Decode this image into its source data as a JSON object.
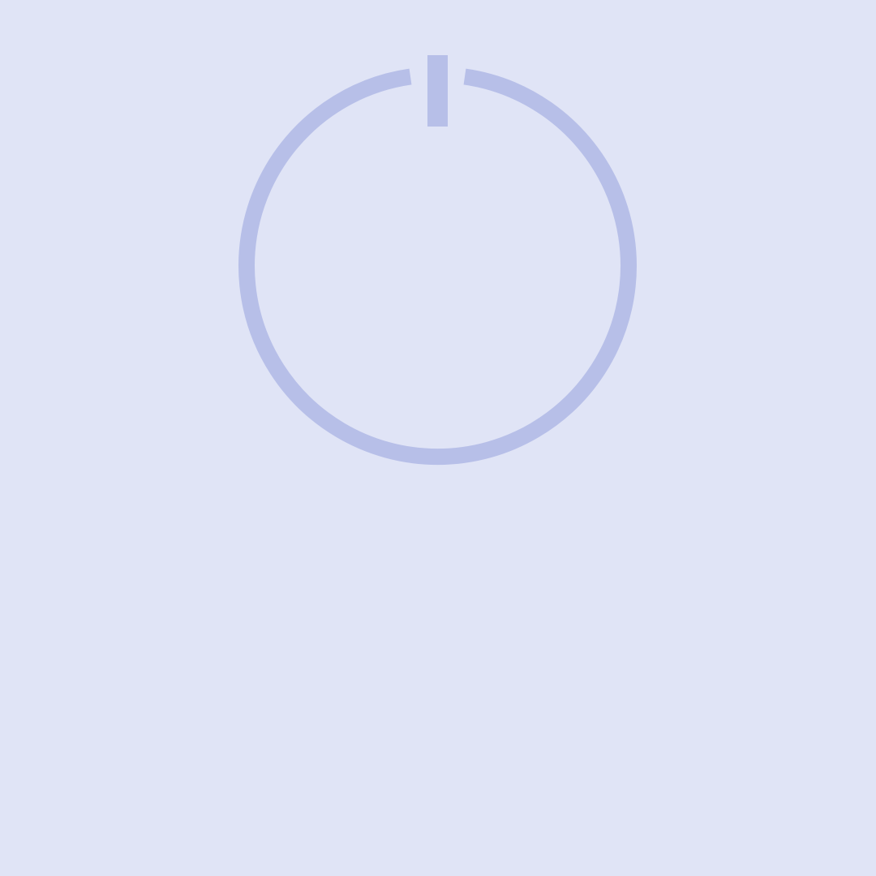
{
  "screen": {
    "background_color": "#E0E4F6"
  },
  "power_button": {
    "icon": "power-icon",
    "color": "#B7BFE8"
  }
}
